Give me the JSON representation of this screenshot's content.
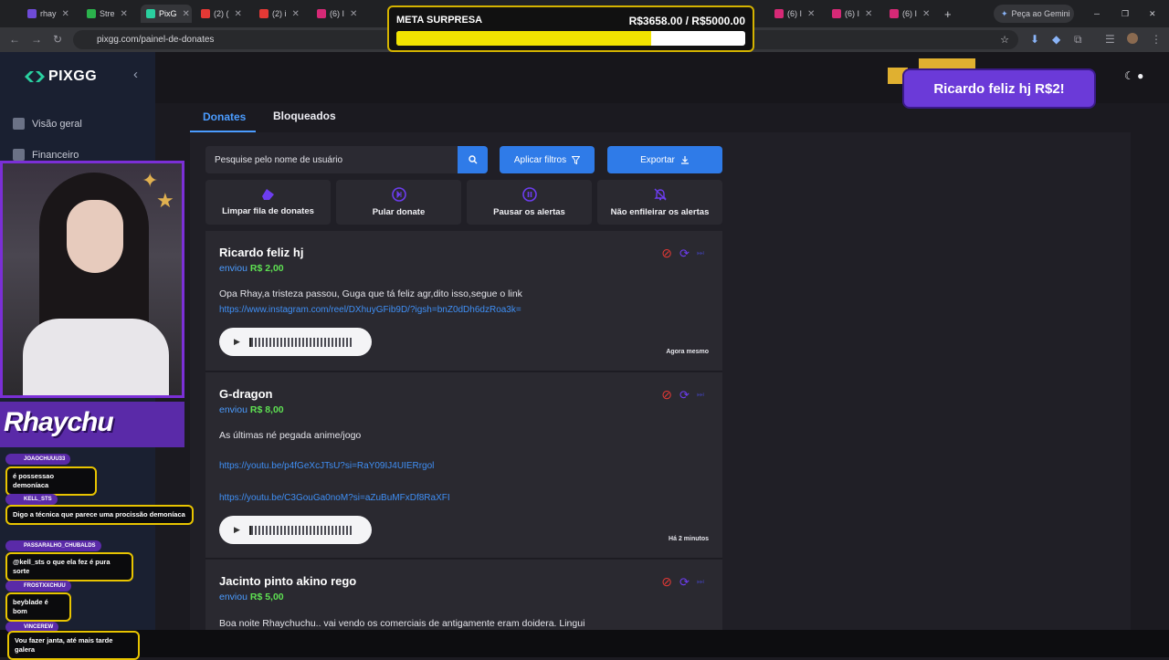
{
  "browser": {
    "tabs": [
      {
        "label": "rhay",
        "color": "#6e4bd8"
      },
      {
        "label": "Stre",
        "color": "#2bb24c"
      },
      {
        "label": "PixG",
        "color": "#2ad0a0",
        "active": true
      },
      {
        "label": "(2) (",
        "color": "#e53935"
      },
      {
        "label": "(2) i",
        "color": "#e53935"
      },
      {
        "label": "(6) I",
        "color": "#d62976"
      },
      {
        "label": "(6) I",
        "color": "#d62976"
      },
      {
        "label": "(6) I",
        "color": "#d62976"
      },
      {
        "label": "(6) I",
        "color": "#d62976"
      }
    ],
    "new_tab": "+",
    "gemini_label": "Peça ao Gemini",
    "url": "pixgg.com/painel-de-donates"
  },
  "meta": {
    "title": "META SURPRESA",
    "amount": "R$3658.00 / R$5000.00",
    "progress": 0.7316
  },
  "sidebar": {
    "logo": "PIXGG",
    "items": [
      {
        "label": "Visão geral"
      },
      {
        "label": "Financeiro"
      }
    ]
  },
  "stream": {
    "banner": "Rhaychu"
  },
  "chat": [
    {
      "user": "JOAOCHUUU33",
      "message": "é possessao demoníaca"
    },
    {
      "user": "KELL_STS",
      "message": "Digo a técnica que parece uma procissão demoníaca"
    },
    {
      "user": "PASSARALHO_CHUBALDS",
      "message": "@kell_sts o que ela fez é pura sorte"
    },
    {
      "user": "FROSTXXCHUU",
      "message": "beyblade é bom"
    },
    {
      "user": "VINCEREW",
      "message": "Vou fazer janta, até mais tarde galera"
    }
  ],
  "tabs": {
    "donates": "Donates",
    "bloqueados": "Bloqueados"
  },
  "search": {
    "placeholder": "Pesquise pelo nome de usuário"
  },
  "buttons": {
    "filters": "Aplicar filtros",
    "export": "Exportar"
  },
  "actions": [
    {
      "label": "Limpar fila de donates",
      "icon": "eraser-icon"
    },
    {
      "label": "Pular donate",
      "icon": "skip-icon"
    },
    {
      "label": "Pausar os alertas",
      "icon": "pause-icon"
    },
    {
      "label": "Não enfileirar os alertas",
      "icon": "bell-off-icon"
    }
  ],
  "donations": [
    {
      "name": "Ricardo feliz hj",
      "sent_label": "enviou",
      "amount": "R$ 2,00",
      "message": "Opa Rhay,a tristeza passou, Guga que tá feliz agr,dito isso,segue o link",
      "links": [
        "https://www.instagram.com/reel/DXhuyGFib9D/?igsh=bnZ0dDh6dzRoa3k="
      ],
      "time": "Agora mesmo"
    },
    {
      "name": "G-dragon",
      "sent_label": "enviou",
      "amount": "R$ 8,00",
      "message": "As últimas né pegada anime/jogo",
      "links": [
        "https://youtu.be/p4fGeXcJTsU?si=RaY09IJ4UIERrgol",
        "https://youtu.be/C3GouGa0noM?si=aZuBuMFxDf8RaXFI"
      ],
      "time": "Há 2 minutos"
    },
    {
      "name": "Jacinto pinto akino rego",
      "sent_label": "enviou",
      "amount": "R$ 5,00",
      "message": "Boa noite Rhaychuchu.. vai vendo os comerciais de antigamente eram doidera. Lingui",
      "links": [],
      "time": ""
    }
  ],
  "alert": {
    "text": "Ricardo feliz hj R$2!"
  },
  "colors": {
    "accent": "#2f7be8",
    "money": "#5ee052",
    "meta_fill": "#f1e300",
    "stream_purple": "#6b3ad8"
  }
}
